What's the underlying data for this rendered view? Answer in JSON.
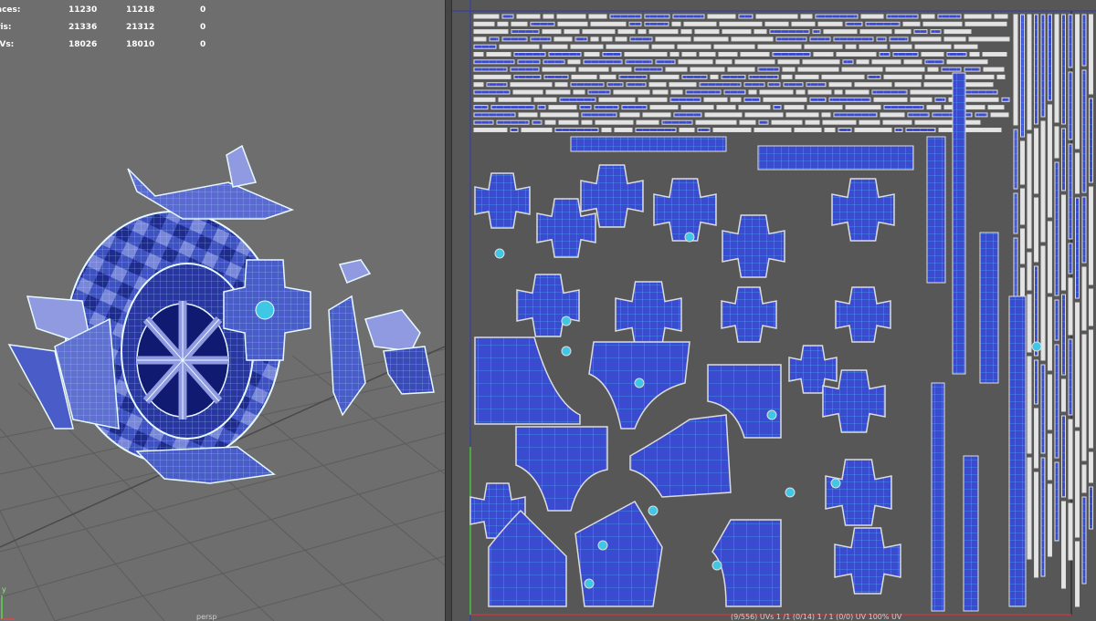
{
  "hud": {
    "rows": [
      {
        "label": "aces:",
        "v1": "11230",
        "v2": "11218",
        "v3": "0"
      },
      {
        "label": "ris:",
        "v1": "21336",
        "v2": "21312",
        "v3": "0"
      },
      {
        "label": "IVs:",
        "v1": "18026",
        "v2": "18010",
        "v3": "0"
      }
    ]
  },
  "viewport": {
    "camera_label": "persp",
    "axis_y_label": "y"
  },
  "uv_editor": {
    "status_text": "(9/556) UVs   1 /1 (0/14)   1 / 1 (0/0)   UV   100%   UV"
  },
  "colors": {
    "viewport_bg": "#6e6e6e",
    "grid_line": "#5a5a5a",
    "uv_bg": "#575757",
    "uv_shell": "#3b4bd0",
    "uv_shell_edge": "#d9d9d9",
    "uv_wire": "#41c7e6",
    "mesh_dark": "#1e2a8c",
    "mesh_mid": "#4a5cc7",
    "mesh_light": "#8f9ae0",
    "mesh_wire": "#b6f2ff"
  }
}
